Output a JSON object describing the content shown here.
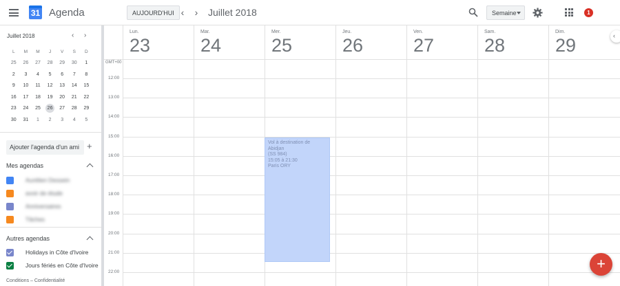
{
  "header": {
    "app_title": "Agenda",
    "logo_day": "31",
    "today_label": "AUJOURD'HUI",
    "prev_label": "‹",
    "next_label": "›",
    "month_title": "Juillet 2018",
    "view_label": "Semaine",
    "notification_count": "1"
  },
  "mini_calendar": {
    "title": "Juillet 2018",
    "prev_label": "‹",
    "next_label": "›",
    "weekday_headers": [
      "L",
      "M",
      "M",
      "J",
      "V",
      "S",
      "D"
    ],
    "weeks": [
      [
        "25",
        "26",
        "27",
        "28",
        "29",
        "30",
        "1"
      ],
      [
        "2",
        "3",
        "4",
        "5",
        "6",
        "7",
        "8"
      ],
      [
        "9",
        "10",
        "11",
        "12",
        "13",
        "14",
        "15"
      ],
      [
        "16",
        "17",
        "18",
        "19",
        "20",
        "21",
        "22"
      ],
      [
        "23",
        "24",
        "25",
        "26",
        "27",
        "28",
        "29"
      ],
      [
        "30",
        "31",
        "1",
        "2",
        "3",
        "4",
        "5"
      ]
    ],
    "today": "26"
  },
  "sidebar": {
    "add_friend_placeholder": "Ajouter l'agenda d'un ami",
    "add_friend_plus": "+",
    "my_calendars_title": "Mes agendas",
    "my_calendars": [
      {
        "label": "Aurélien Dessein",
        "color": "#4285f4"
      },
      {
        "label": "avoir de étude",
        "color": "#f6891f"
      },
      {
        "label": "Anniversaires",
        "color": "#7986cb"
      },
      {
        "label": "Tâches",
        "color": "#f6891f"
      }
    ],
    "other_calendars_title": "Autres agendas",
    "other_calendars": [
      {
        "label": "Holidays in Côte d'Ivoire",
        "color": "#7986cb"
      },
      {
        "label": "Jours fériés en Côte d'Ivoire",
        "color": "#0b8043"
      }
    ],
    "footer": "Conditions – Confidentialité"
  },
  "week": {
    "timezone": "GMT+00",
    "days": [
      {
        "name": "Lun.",
        "num": "23"
      },
      {
        "name": "Mar.",
        "num": "24"
      },
      {
        "name": "Mer.",
        "num": "25"
      },
      {
        "name": "Jeu.",
        "num": "26"
      },
      {
        "name": "Ven.",
        "num": "27"
      },
      {
        "name": "Sam.",
        "num": "28"
      },
      {
        "name": "Dim.",
        "num": "29"
      }
    ],
    "hours": [
      "12:00",
      "13:00",
      "14:00",
      "15:00",
      "16:00",
      "17:00",
      "18:00",
      "19:00",
      "20:00",
      "21:00",
      "22:00"
    ]
  },
  "event": {
    "line1": "Vol à destination de Abidjan",
    "line2": "(SS 984)",
    "line3": "15:05 à 21:30",
    "line4": "Paris ORY",
    "color": "#c2d5fa"
  },
  "fab_label": "+",
  "side_toggle_label": "‹"
}
